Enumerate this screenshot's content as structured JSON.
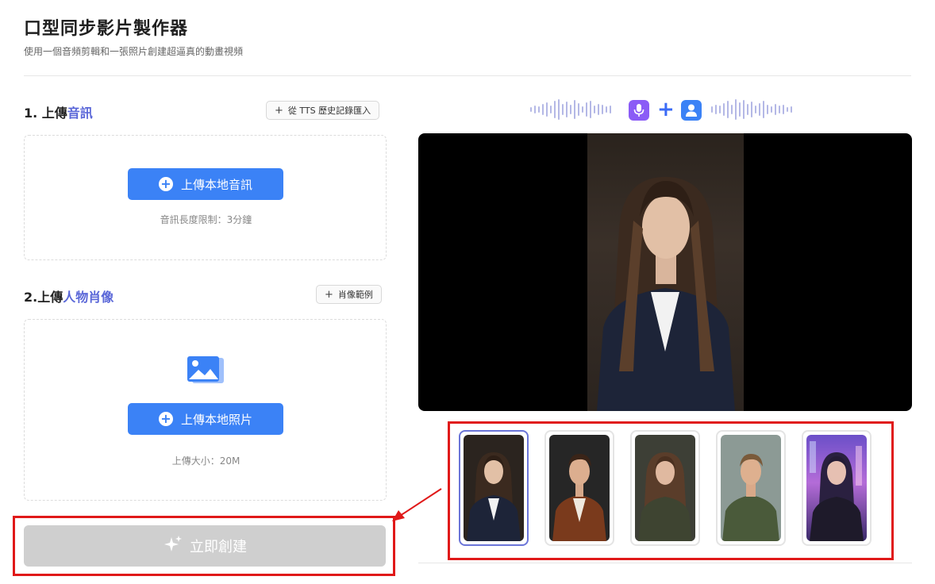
{
  "header": {
    "title": "口型同步影片製作器",
    "subtitle": "使用一個音頻剪輯和一張照片創建超逼真的動畫視頻"
  },
  "audio_section": {
    "title_prefix": "1. 上傳",
    "title_accent": "音訊",
    "import_button": "從 TTS 歷史記錄匯入",
    "upload_button": "上傳本地音訊",
    "hint": "音訊長度限制：3分鐘"
  },
  "portrait_section": {
    "title_prefix": "2.上傳",
    "title_accent": "人物肖像",
    "example_button": "肖像範例",
    "upload_button": "上傳本地照片",
    "hint": "上傳大小：20M"
  },
  "create_button": "立即創建",
  "colors": {
    "primary": "#3b82f6",
    "accent": "#5a67d8",
    "highlight": "#e01919",
    "disabled": "#cfcfcf"
  },
  "icons": [
    "plus-icon",
    "plus-circle-icon",
    "image-icon",
    "sparkle-icon",
    "microphone-icon",
    "person-icon",
    "waveform-icon"
  ],
  "samples": [
    {
      "name": "woman-black-blazer",
      "selected": true
    },
    {
      "name": "man-brown-jacket",
      "selected": false
    },
    {
      "name": "woman-olive-top",
      "selected": false
    },
    {
      "name": "man-olive-shirt",
      "selected": false
    },
    {
      "name": "woman-cyberpunk",
      "selected": false
    }
  ]
}
